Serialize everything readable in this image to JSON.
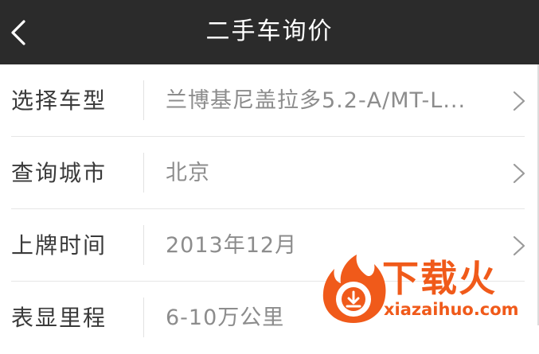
{
  "header": {
    "title": "二手车询价",
    "back_icon": "chevron-left-icon"
  },
  "rows": [
    {
      "label": "选择车型",
      "value": "兰博基尼盖拉多5.2-A/MT-L..."
    },
    {
      "label": "查询城市",
      "value": "北京"
    },
    {
      "label": "上牌时间",
      "value": "2013年12月"
    },
    {
      "label": "表显里程",
      "value": "6-10万公里"
    }
  ],
  "watermark": {
    "title": "下载火",
    "url": "xiazaihuo.com",
    "color": "#f05a1a"
  }
}
